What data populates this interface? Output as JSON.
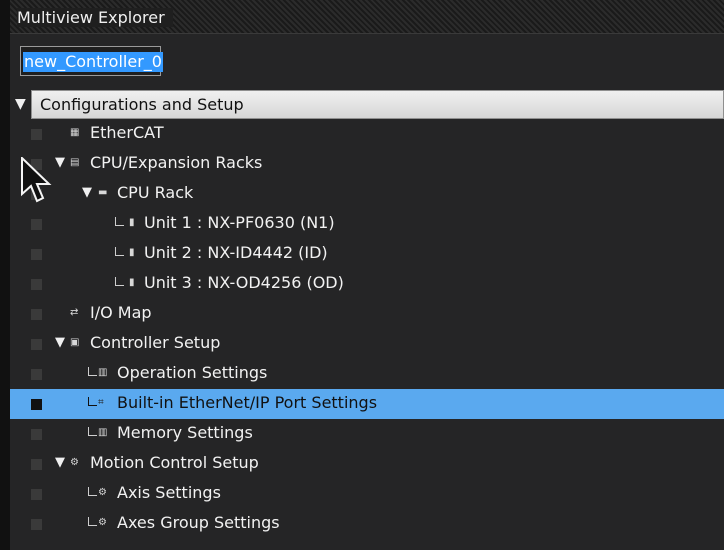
{
  "window": {
    "title": "Multiview Explorer",
    "controller_name": "new_Controller_0"
  },
  "section": {
    "title": "Configurations and Setup"
  },
  "tree": {
    "items": [
      {
        "label": "EtherCAT",
        "icon": "ethercat-icon"
      },
      {
        "label": "CPU/Expansion Racks",
        "icon": "rack-icon",
        "expanded": true
      },
      {
        "label": "CPU Rack",
        "icon": "cpu-rack-icon",
        "expanded": true
      },
      {
        "label": "Unit 1 : NX-PF0630 (N1)",
        "icon": "unit-icon"
      },
      {
        "label": "Unit 2 : NX-ID4442 (ID)",
        "icon": "unit-icon"
      },
      {
        "label": "Unit 3 : NX-OD4256 (OD)",
        "icon": "unit-icon"
      },
      {
        "label": "I/O Map",
        "icon": "io-map-icon"
      },
      {
        "label": "Controller Setup",
        "icon": "controller-setup-icon",
        "expanded": true
      },
      {
        "label": "Operation Settings",
        "icon": "operation-settings-icon"
      },
      {
        "label": "Built-in EtherNet/IP Port Settings",
        "icon": "ethernet-port-icon",
        "selected": true
      },
      {
        "label": "Memory Settings",
        "icon": "memory-icon"
      },
      {
        "label": "Motion Control Setup",
        "icon": "gear-icon",
        "expanded": true
      },
      {
        "label": "Axis Settings",
        "icon": "axis-icon"
      },
      {
        "label": "Axes Group Settings",
        "icon": "axes-group-icon"
      }
    ]
  },
  "colors": {
    "background": "#252526",
    "selection": "#5aa9ef",
    "header": "#e6e6e6",
    "text": "#f2f2f2"
  }
}
